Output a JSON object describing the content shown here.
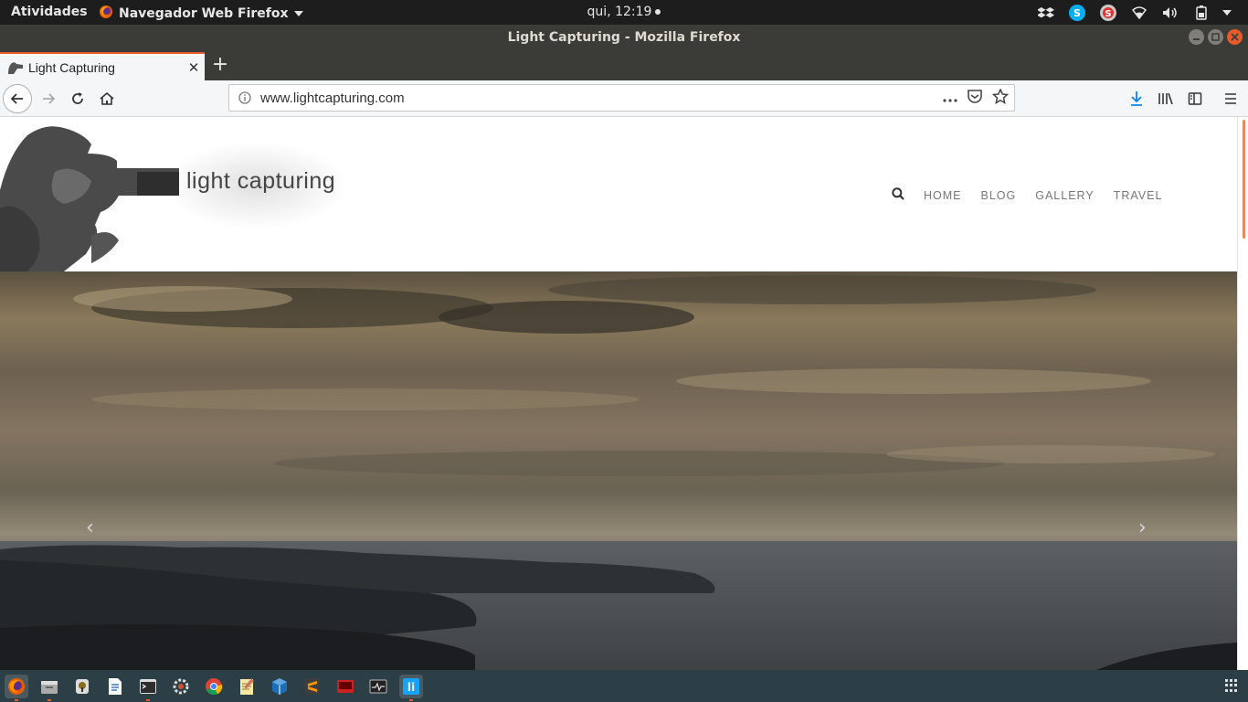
{
  "topbar": {
    "activities": "Atividades",
    "app_menu": "Navegador Web Firefox",
    "clock": "qui, 12:19"
  },
  "window": {
    "title": "Light Capturing - Mozilla Firefox"
  },
  "tab": {
    "label": "Light Capturing"
  },
  "urlbar": {
    "url": "www.lightcapturing.com"
  },
  "site": {
    "logo_text": "light capturing",
    "nav": [
      "HOME",
      "BLOG",
      "GALLERY",
      "TRAVEL"
    ]
  },
  "colors": {
    "accent": "#e75a2c",
    "topbar": "#1d1d1d",
    "titlebar": "#3b3b37",
    "dock": "#2c3e46"
  },
  "dock": {
    "apps": [
      "firefox-icon",
      "files-icon",
      "password-keyring-icon",
      "text-editor-icon",
      "terminal-icon",
      "settings-icon",
      "chrome-icon",
      "notes-icon",
      "virtualbox-icon",
      "sublime-text-icon",
      "screen-recorder-icon",
      "system-monitor-icon",
      "libreoffice-icon"
    ]
  }
}
